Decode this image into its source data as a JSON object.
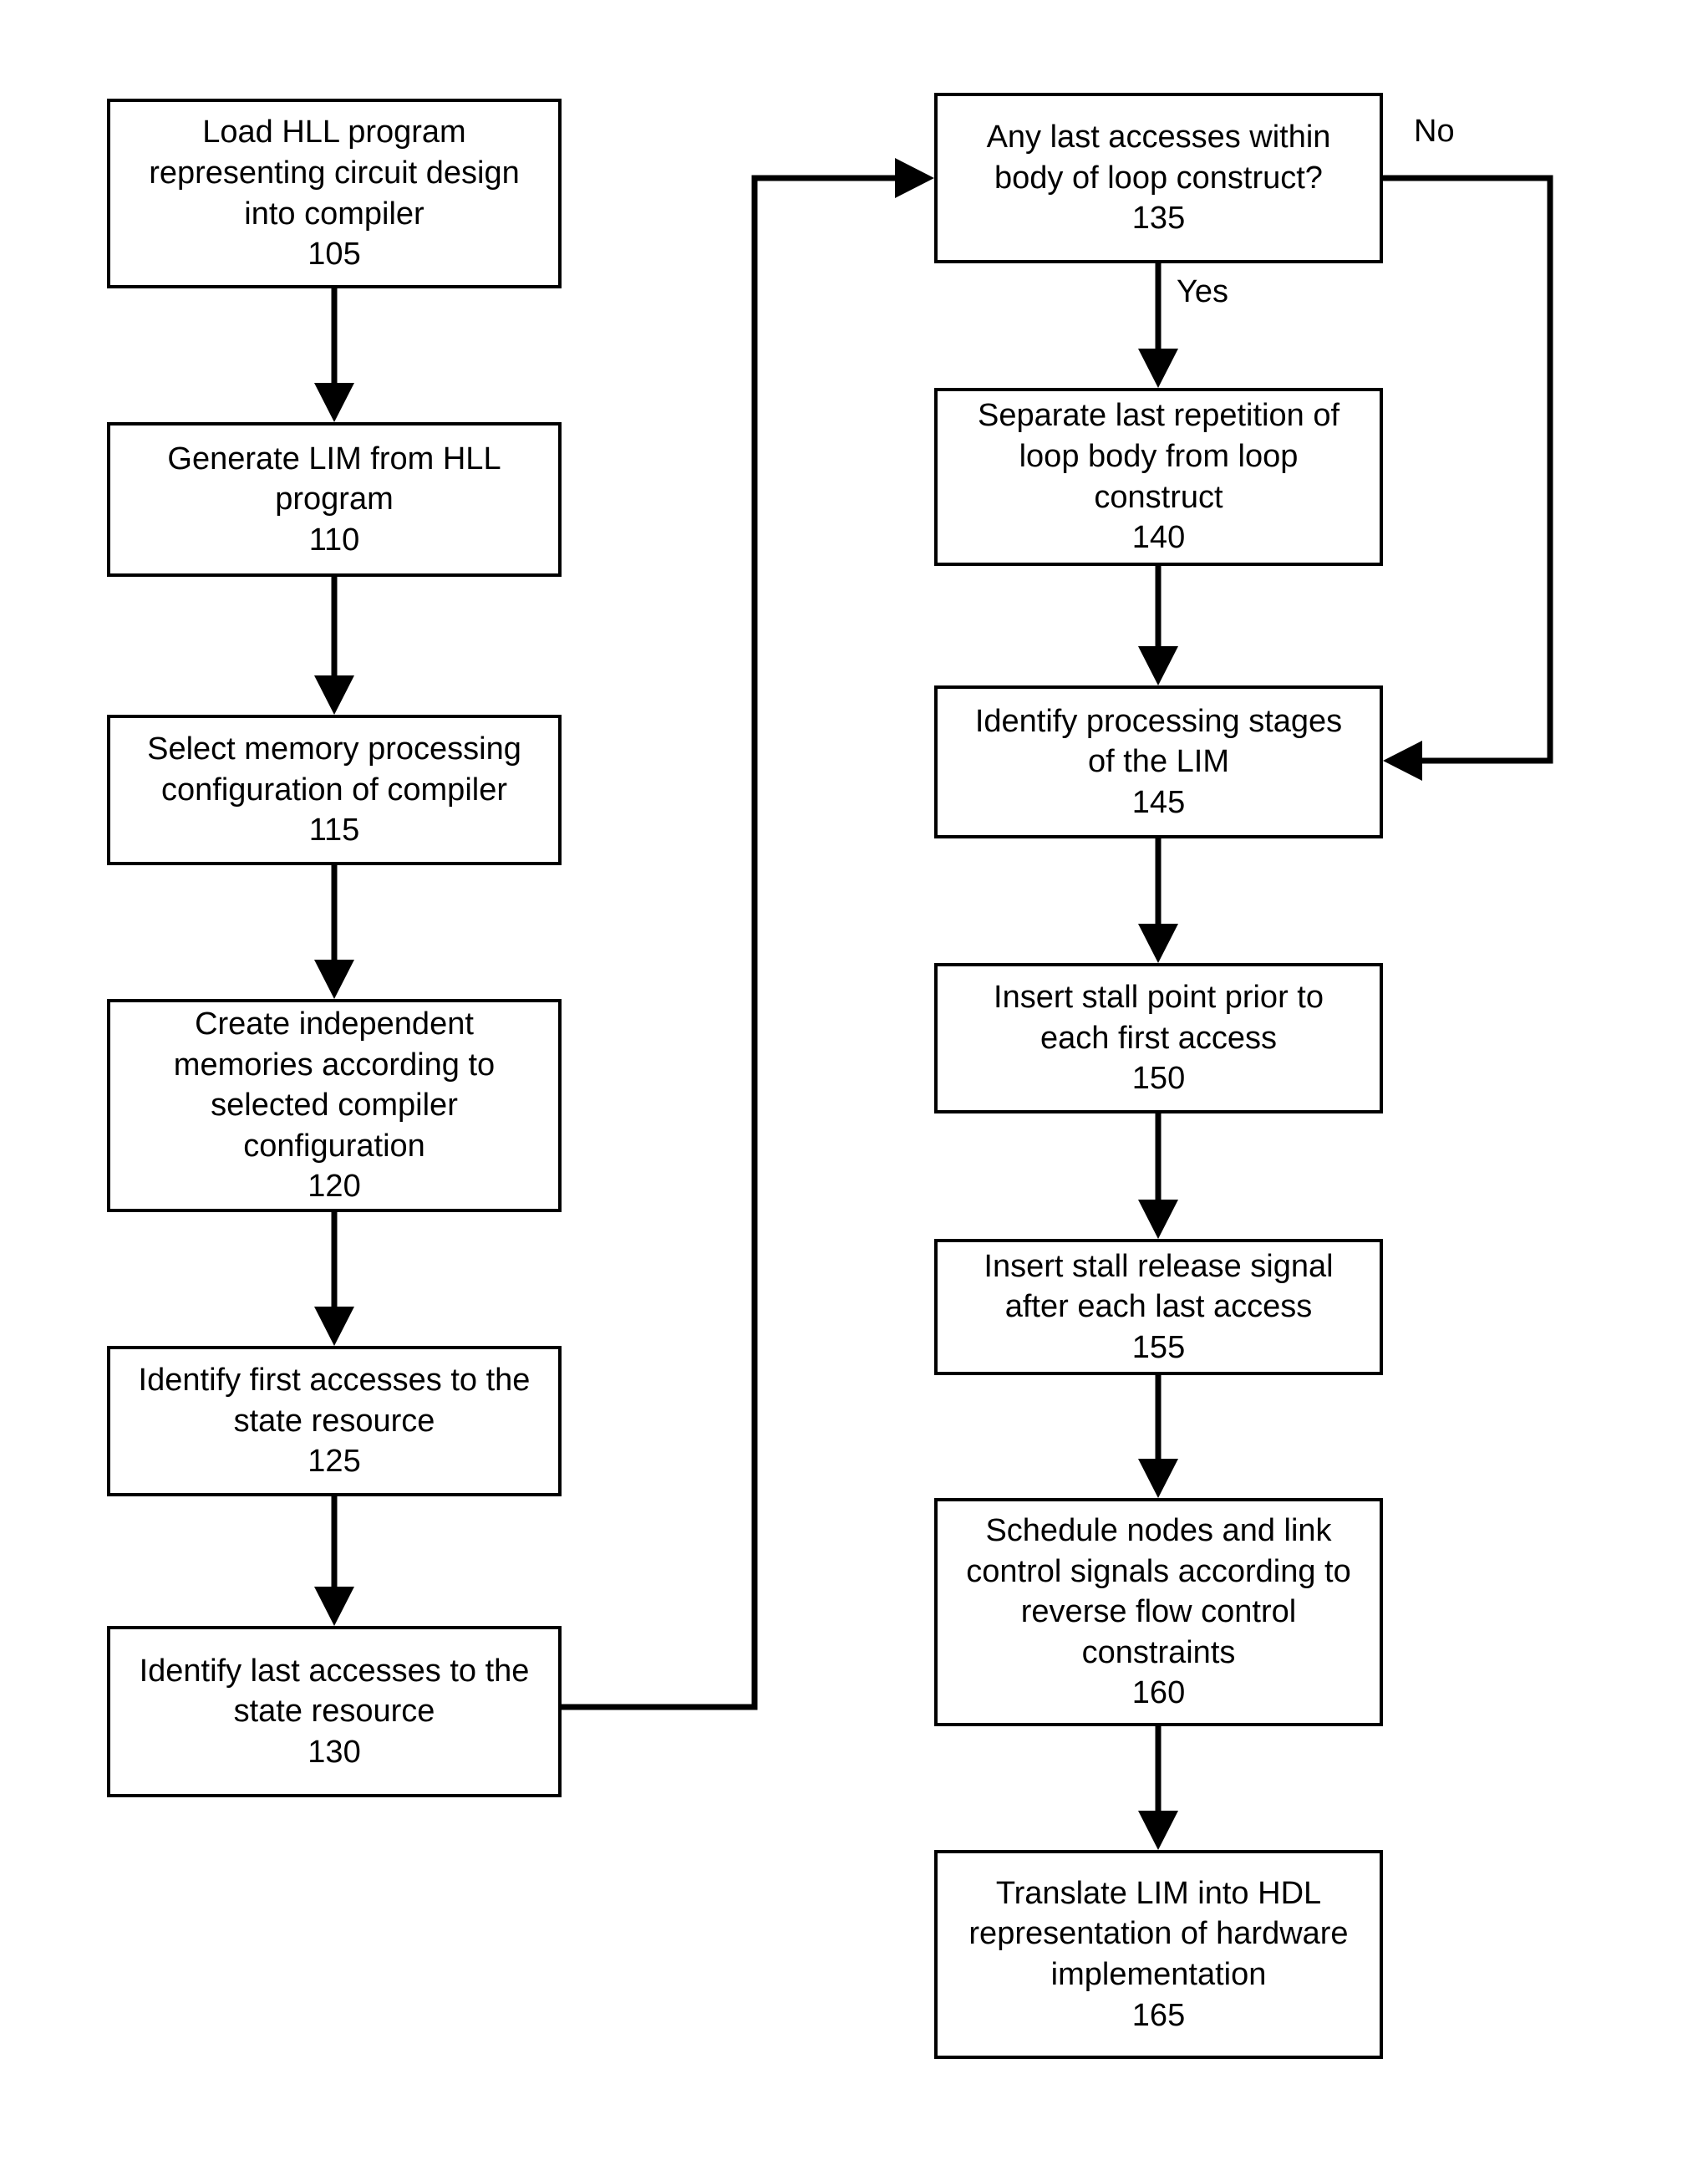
{
  "diagram": {
    "title": "Compiler flow for generating hardware from an HLL program",
    "background_color": "#ffffff",
    "line_color": "#000000",
    "text_color": "#000000"
  },
  "nodes": {
    "n105": {
      "id": "105",
      "lines": [
        "Load HLL program",
        "representing circuit design",
        "into compiler",
        "105"
      ]
    },
    "n110": {
      "id": "110",
      "lines": [
        "Generate LIM from HLL",
        "program",
        "110"
      ]
    },
    "n115": {
      "id": "115",
      "lines": [
        "Select memory processing",
        "configuration of compiler",
        "115"
      ]
    },
    "n120": {
      "id": "120",
      "lines": [
        "Create independent",
        "memories according to",
        "selected compiler",
        "configuration",
        "120"
      ]
    },
    "n125": {
      "id": "125",
      "lines": [
        "Identify first accesses to the",
        "state resource",
        "125"
      ]
    },
    "n130": {
      "id": "130",
      "lines": [
        "Identify last accesses to the",
        "state resource",
        "130"
      ]
    },
    "n135": {
      "id": "135",
      "lines": [
        "Any last accesses within",
        "body of loop construct?",
        "135"
      ]
    },
    "n140": {
      "id": "140",
      "lines": [
        "Separate last repetition of",
        "loop body from loop",
        "construct",
        "140"
      ]
    },
    "n145": {
      "id": "145",
      "lines": [
        "Identify processing stages",
        "of the LIM",
        "145"
      ]
    },
    "n150": {
      "id": "150",
      "lines": [
        "Insert stall point prior to",
        "each first access",
        "150"
      ]
    },
    "n155": {
      "id": "155",
      "lines": [
        "Insert stall release signal",
        "after each last access",
        "155"
      ]
    },
    "n160": {
      "id": "160",
      "lines": [
        "Schedule nodes and link",
        "control signals according to",
        "reverse flow control",
        "constraints",
        "160"
      ]
    },
    "n165": {
      "id": "165",
      "lines": [
        "Translate LIM into HDL",
        "representation of hardware",
        "implementation",
        "165"
      ]
    }
  },
  "edge_labels": {
    "no": "No",
    "yes": "Yes"
  },
  "chart_data": {
    "type": "diagram",
    "subtype": "flowchart",
    "orientation": "two-column top-to-bottom",
    "steps": [
      {
        "ref": "105",
        "text": "Load HLL program representing circuit design into compiler"
      },
      {
        "ref": "110",
        "text": "Generate LIM from HLL program"
      },
      {
        "ref": "115",
        "text": "Select memory processing configuration of compiler"
      },
      {
        "ref": "120",
        "text": "Create independent memories according to selected compiler configuration"
      },
      {
        "ref": "125",
        "text": "Identify first accesses to the state resource"
      },
      {
        "ref": "130",
        "text": "Identify last accesses to the state resource"
      },
      {
        "ref": "135",
        "text": "Any last accesses within body of loop construct?",
        "kind": "decision"
      },
      {
        "ref": "140",
        "text": "Separate last repetition of loop body from loop construct"
      },
      {
        "ref": "145",
        "text": "Identify processing stages of the LIM"
      },
      {
        "ref": "150",
        "text": "Insert stall point prior to each first access"
      },
      {
        "ref": "155",
        "text": "Insert stall release signal after each last access"
      },
      {
        "ref": "160",
        "text": "Schedule nodes and link control signals according to reverse flow control constraints"
      },
      {
        "ref": "165",
        "text": "Translate LIM into HDL representation of hardware implementation"
      }
    ],
    "edges": [
      {
        "from": "105",
        "to": "110",
        "label": ""
      },
      {
        "from": "110",
        "to": "115",
        "label": ""
      },
      {
        "from": "115",
        "to": "120",
        "label": ""
      },
      {
        "from": "120",
        "to": "125",
        "label": ""
      },
      {
        "from": "125",
        "to": "130",
        "label": ""
      },
      {
        "from": "130",
        "to": "135",
        "label": ""
      },
      {
        "from": "135",
        "to": "140",
        "label": "Yes"
      },
      {
        "from": "135",
        "to": "145",
        "label": "No"
      },
      {
        "from": "140",
        "to": "145",
        "label": ""
      },
      {
        "from": "145",
        "to": "150",
        "label": ""
      },
      {
        "from": "150",
        "to": "155",
        "label": ""
      },
      {
        "from": "155",
        "to": "160",
        "label": ""
      },
      {
        "from": "160",
        "to": "165",
        "label": ""
      }
    ]
  }
}
